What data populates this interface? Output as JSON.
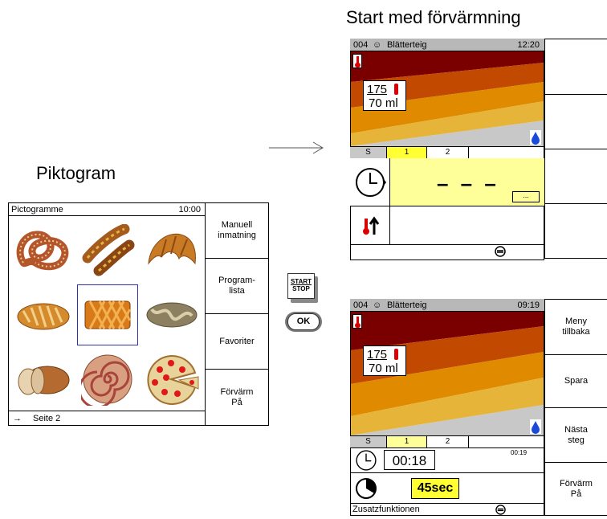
{
  "headings": {
    "preheat_title": "Start med förvärmning",
    "pictogram_title": "Piktogram"
  },
  "pictogram_screen": {
    "title": "Pictogramme",
    "time": "10:00",
    "footer": "Seite 2",
    "tiles": [
      "pretzel",
      "sausage-rolls",
      "croissant",
      "braided-bread",
      "lattice-pastry",
      "plait",
      "sliced-bread",
      "cinnamon-swirl",
      "pizza"
    ],
    "selected_tile": 4,
    "buttons": [
      "Manuell\ninmatning",
      "Program-\nlista",
      "Favoriter",
      "Förvärm\nPå"
    ]
  },
  "keys": {
    "start_stop": [
      "START",
      "STOP"
    ],
    "ok": "OK"
  },
  "preheat_screen": {
    "program_no": "004",
    "program_name": "Blätterteig",
    "time": "12:20",
    "temperature": "175",
    "volume": "70 ml",
    "tabs": [
      "S",
      "1",
      "2"
    ],
    "active_tab": 1,
    "timer_value": "– – –",
    "more": "..."
  },
  "running_screen": {
    "program_no": "004",
    "program_name": "Blätterteig",
    "time": "09:19",
    "temperature": "175",
    "volume": "70 ml",
    "tabs": [
      "S",
      "1",
      "2"
    ],
    "active_tab": 1,
    "timer_value": "00:18",
    "timer_small": "00:19",
    "duration_value": "45sec",
    "footer": "Zusatzfunktionen",
    "buttons": [
      "Meny\ntillbaka",
      "Spara",
      "Nästa\nsteg",
      "Förvärm\nPå"
    ]
  },
  "colors": {
    "maroon": "#7a0000",
    "red_orange": "#c24a00",
    "orange": "#e08a00",
    "gold": "#e7b43a",
    "yellow_highlight": "#ffff99",
    "gray_bar": "#b8b8b8",
    "selection_blue": "#3333aa"
  }
}
